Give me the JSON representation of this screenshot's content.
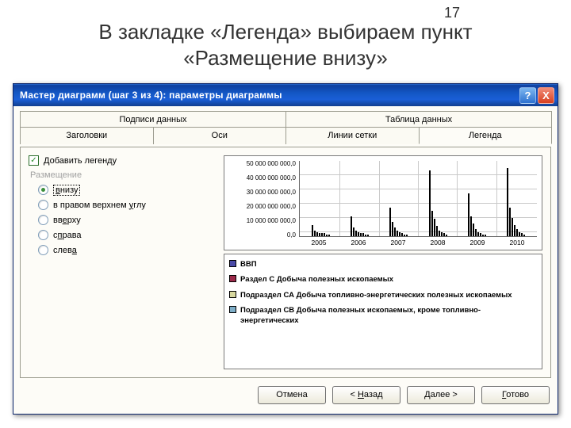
{
  "slide": {
    "number": "17",
    "title_line1": "В закладке «Легенда» выбираем пункт",
    "title_line2": "«Размещение внизу»"
  },
  "window": {
    "title": "Мастер диаграмм (шаг 3 из 4): параметры диаграммы",
    "help_glyph": "?",
    "close_glyph": "X"
  },
  "tabs": {
    "row1": [
      "Подписи данных",
      "Таблица данных"
    ],
    "row2": [
      "Заголовки",
      "Оси",
      "Линии сетки",
      "Легенда"
    ]
  },
  "legend_panel": {
    "checkbox_label": "Добавить легенду",
    "checkbox_checked": true,
    "group_label": "Размещение",
    "options": [
      {
        "pre": "",
        "u": "в",
        "post": "низу",
        "selected": true
      },
      {
        "pre": "в правом верхнем ",
        "u": "у",
        "post": "глу",
        "selected": false
      },
      {
        "pre": "вв",
        "u": "е",
        "post": "рху",
        "selected": false
      },
      {
        "pre": "с",
        "u": "п",
        "post": "рава",
        "selected": false
      },
      {
        "pre": "слев",
        "u": "а",
        "post": "",
        "selected": false
      }
    ]
  },
  "chart_data": {
    "type": "bar",
    "title": "",
    "xlabel": "",
    "ylabel": "",
    "ylim": [
      0,
      50000000000
    ],
    "y_ticks": [
      "50 000 000 000,0",
      "40 000 000 000,0",
      "30 000 000 000,0",
      "20 000 000 000,0",
      "10 000 000 000,0",
      "0,0"
    ],
    "categories": [
      "2005",
      "2006",
      "2007",
      "2008",
      "2009",
      "2010"
    ],
    "series": [
      {
        "name": "ВВП",
        "values": [
          12,
          18,
          23,
          42,
          30,
          44
        ]
      },
      {
        "name": "Раздел С Добыча полезных ископаемых",
        "values": [
          6,
          10,
          14,
          20,
          16,
          22
        ]
      },
      {
        "name": "Подраздел СА Добыча топливно-энергетических полезных ископаемых",
        "values": [
          5,
          9,
          12,
          18,
          14,
          20
        ]
      },
      {
        "name": "Подраздел СВ Добыча полезных ископаемых, кроме топливно-энергетических",
        "values": [
          3,
          5,
          6,
          8,
          6,
          9
        ]
      }
    ],
    "preview_bar_heights": [
      [
        8,
        4,
        3,
        2,
        2,
        2,
        1,
        1
      ],
      [
        14,
        6,
        4,
        3,
        2,
        2,
        1,
        1
      ],
      [
        20,
        10,
        6,
        4,
        3,
        2,
        1,
        1
      ],
      [
        46,
        18,
        12,
        7,
        4,
        3,
        2,
        1
      ],
      [
        30,
        14,
        9,
        5,
        3,
        2,
        1,
        1
      ],
      [
        48,
        20,
        13,
        8,
        5,
        3,
        2,
        1
      ]
    ]
  },
  "buttons": {
    "cancel": "Отмена",
    "back_pre": "< ",
    "back_u": "Н",
    "back_post": "азад",
    "next_pre": "",
    "next_u": "Д",
    "next_post": "алее >",
    "finish_pre": "",
    "finish_u": "Г",
    "finish_post": "отово"
  }
}
